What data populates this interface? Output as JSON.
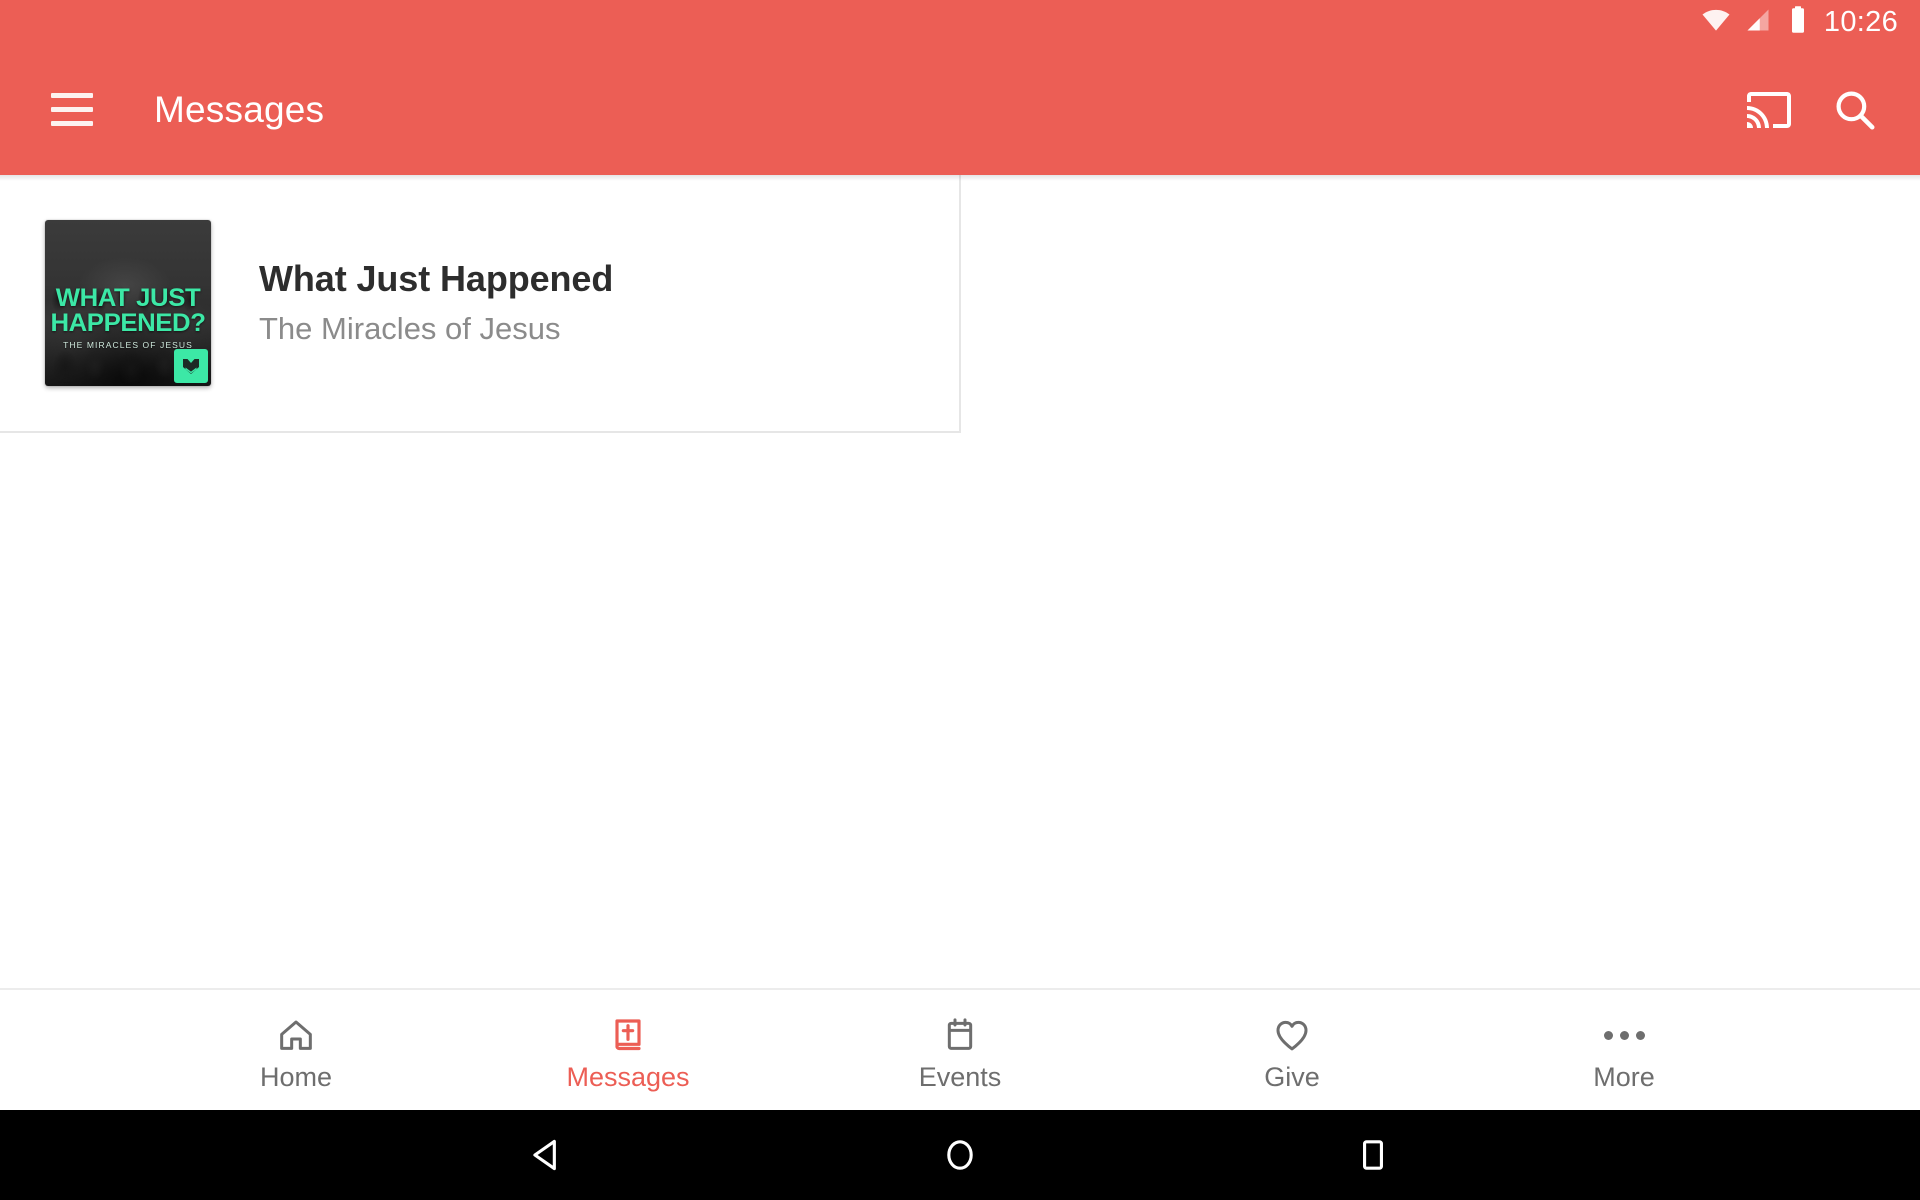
{
  "theme": {
    "accent": "#EC5E55",
    "accent_text_on_dark": "#EC5E55",
    "badge_green": "#3CE8A6",
    "title_color": "#2D2D2D",
    "subtitle_color": "#8B8B8B",
    "nav_inactive": "#6E6E6E",
    "system_nav_bg": "#000000",
    "page_bg": "#FFFFFF"
  },
  "status_bar": {
    "clock": "10:26",
    "icons": [
      {
        "name": "wifi-icon",
        "label": "Wi-Fi"
      },
      {
        "name": "cellular-signal-icon",
        "label": "Cellular signal"
      },
      {
        "name": "battery-icon",
        "label": "Battery"
      }
    ]
  },
  "toolbar": {
    "menu_icon": "hamburger-menu-icon",
    "title": "Messages",
    "actions": [
      {
        "name": "cast-icon",
        "label": "Cast"
      },
      {
        "name": "search-icon",
        "label": "Search"
      }
    ]
  },
  "main": {
    "list": [
      {
        "title": "What Just Happened",
        "subtitle": "The Miracles of Jesus",
        "thumbnail": {
          "line1": "WHAT JUST",
          "line2": "HAPPENED?",
          "sub": "THE MIRACLES OF JESUS",
          "badge_icon": "church-logo-badge-icon"
        }
      }
    ]
  },
  "bottom_nav": {
    "active_index": 1,
    "items": [
      {
        "label": "Home",
        "icon": "home-icon"
      },
      {
        "label": "Messages",
        "icon": "bible-cross-icon"
      },
      {
        "label": "Events",
        "icon": "calendar-icon"
      },
      {
        "label": "Give",
        "icon": "heart-icon"
      },
      {
        "label": "More",
        "icon": "more-dots-icon"
      }
    ]
  },
  "system_nav": {
    "buttons": [
      {
        "name": "android-back-button",
        "label": "Back"
      },
      {
        "name": "android-home-button",
        "label": "Home"
      },
      {
        "name": "android-recents-button",
        "label": "Recents"
      }
    ]
  }
}
